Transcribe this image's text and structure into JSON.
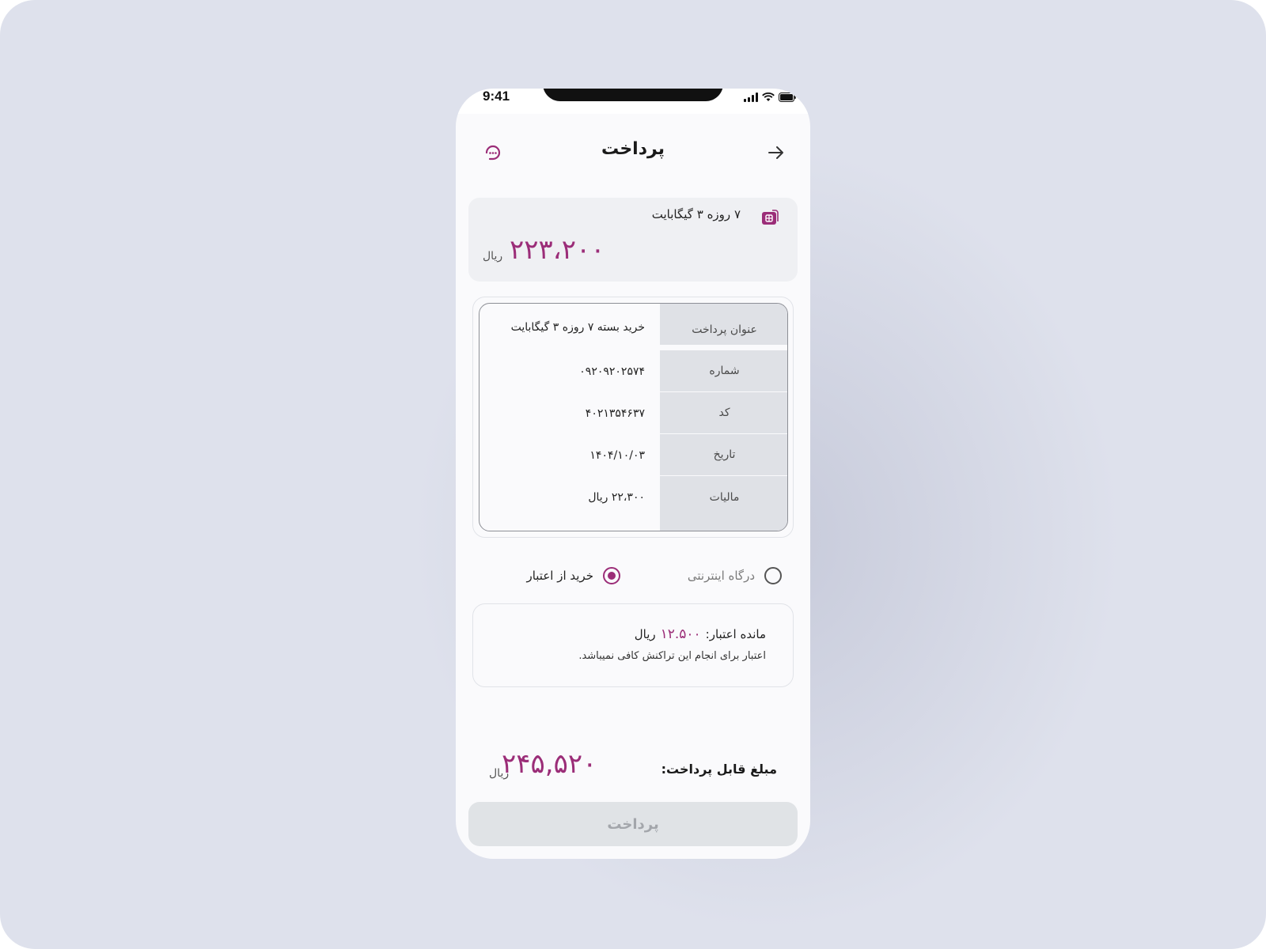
{
  "status_bar": {
    "time": "9:41"
  },
  "header": {
    "title": "پرداخت",
    "back_icon": "arrow-right-icon",
    "support_icon": "support-chat-icon"
  },
  "package": {
    "icon": "sim-card-icon",
    "name": "۷ روزه ۳ گیگابایت",
    "price": "۲۲۳،۲۰۰",
    "unit": "ریال"
  },
  "details": [
    {
      "label": "عنوان پرداخت",
      "value": "خرید بسته ۷ روزه ۳ گیگابایت"
    },
    {
      "label": "شماره",
      "value": "۰۹۲۰۹۲۰۲۵۷۴"
    },
    {
      "label": "کد",
      "value": "۴۰۲۱۳۵۴۶۳۷"
    },
    {
      "label": "تاریخ",
      "value": "۱۴۰۴/۱۰/۰۳"
    },
    {
      "label": "مالیات",
      "value": "۲۲،۳۰۰ ریال"
    }
  ],
  "payment_methods": {
    "credit": {
      "label": "خرید از اعتبار",
      "selected": true
    },
    "gateway": {
      "label": "درگاه اینترنتی",
      "selected": false
    }
  },
  "credit_info": {
    "balance_label": "مانده اعتبار:",
    "balance_amount": "۱۲.۵۰۰",
    "balance_unit": "ریال",
    "message": "اعتبار برای انجام این تراکنش کافی نمیباشد."
  },
  "payable": {
    "label": "مبلغ قابل پرداخت:",
    "amount": "۲۴۵,۵۲۰",
    "unit": "ریال"
  },
  "pay_button": {
    "label": "پرداخت",
    "enabled": false
  },
  "colors": {
    "accent": "#9b2d78",
    "background": "#dee1ec",
    "disabled_button": "#e0e3e6"
  }
}
